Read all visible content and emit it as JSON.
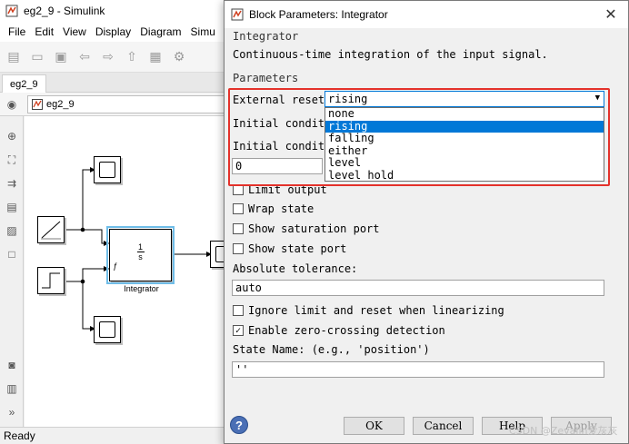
{
  "main_window": {
    "title": "eg2_9 - Simulink",
    "menu": [
      "File",
      "Edit",
      "View",
      "Display",
      "Diagram",
      "Simu"
    ],
    "tab": "eg2_9",
    "breadcrumb": "eg2_9",
    "status": "Ready",
    "integrator_label": "Integrator",
    "integrator_num": "1",
    "integrator_den": "s"
  },
  "dialog": {
    "title": "Block Parameters: Integrator",
    "section_integrator": "Integrator",
    "description": "Continuous-time integration of the input signal.",
    "section_parameters": "Parameters",
    "external_reset_label": "External reset:",
    "external_reset_value": "rising",
    "reset_options": [
      "none",
      "rising",
      "falling",
      "either",
      "level",
      "level hold"
    ],
    "initial_condition_label_1": "Initial conditio",
    "initial_condition_label_2": "Initial conditio",
    "initial_condition_value": "0",
    "checkboxes": [
      {
        "label": "Limit output",
        "checked": false
      },
      {
        "label": "Wrap state",
        "checked": false
      },
      {
        "label": "Show saturation port",
        "checked": false
      },
      {
        "label": "Show state port",
        "checked": false
      }
    ],
    "absolute_tolerance_label": "Absolute tolerance:",
    "absolute_tolerance_value": "auto",
    "checkbox_ignore": {
      "label": "Ignore limit and reset when linearizing",
      "checked": false
    },
    "checkbox_zero_crossing": {
      "label": "Enable zero-crossing detection",
      "checked": true
    },
    "state_name_label": "State Name: (e.g., 'position')",
    "state_name_value": "''",
    "buttons": {
      "ok": "OK",
      "cancel": "Cancel",
      "help": "Help",
      "apply": "Apply"
    },
    "help_icon": "?",
    "highlight_color": "#e4322b",
    "selected_color": "#0078d7"
  },
  "watermark": "CSDN @Zevalin爱灰灰"
}
